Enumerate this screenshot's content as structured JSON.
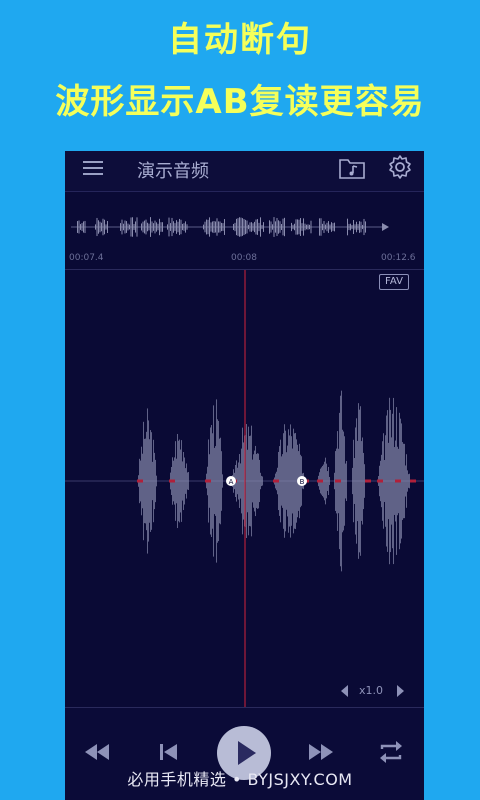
{
  "promo": {
    "line1": "自动断句",
    "line2": "波形显示AB复读更容易"
  },
  "app": {
    "title": "演示音频",
    "icons": [
      "menu-icon",
      "music-folder-icon",
      "gear-icon"
    ]
  },
  "overview": {
    "times": [
      "00:07.4",
      "00:08",
      "00:12.6"
    ]
  },
  "waveform": {
    "fav_label": "FAV",
    "marker_a": "A",
    "marker_b": "B"
  },
  "speed": {
    "value": "x1.0"
  },
  "controls": {
    "icons": [
      "rewind-icon",
      "previous-icon",
      "play-icon",
      "fast-forward-icon",
      "repeat-icon"
    ]
  },
  "watermark": {
    "text": "必用手机精选 • BYJSJXY.COM"
  },
  "colors": {
    "background": "#1fa8f0",
    "promo_text": "#f5ff5a",
    "app_bg": "#0a0a35",
    "wave": "#8a8cae",
    "playhead": "#b0203a"
  }
}
